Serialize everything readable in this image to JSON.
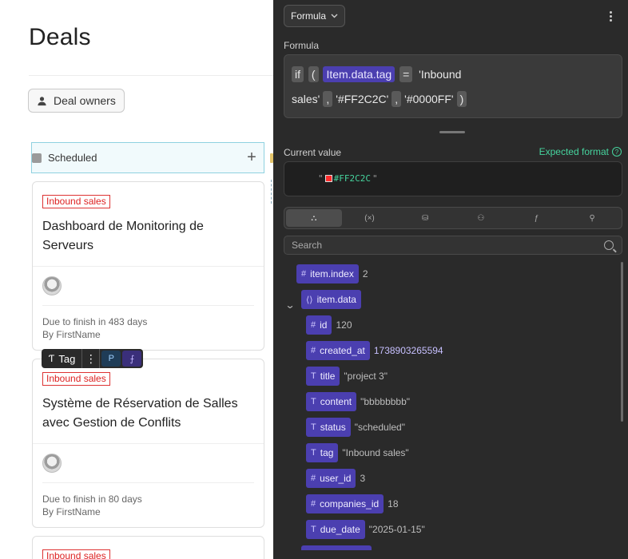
{
  "board": {
    "title": "Deals",
    "owners_button": "Deal owners",
    "column": {
      "label": "Scheduled",
      "add": "+"
    },
    "cards": [
      {
        "tag": "Inbound sales",
        "title": "Dashboard de Monitoring de Serveurs",
        "due": "Due to finish in 483 days",
        "by": "By FirstName"
      },
      {
        "tag": "Inbound sales",
        "title": "Système de Réservation de Salles avec Gestion de Conflits",
        "due": "Due to finish in 80 days",
        "by": "By FirstName"
      },
      {
        "tag": "Inbound sales"
      }
    ],
    "toolbar": {
      "tag_label": "Tag",
      "more": "⋮",
      "p": "P",
      "f": "⨍"
    }
  },
  "panel": {
    "select_label": "Formula",
    "formula_label": "Formula",
    "formula_tokens": {
      "if": "if",
      "open": "(",
      "var": "Item.data.tag",
      "eq": "=",
      "str1_a": "'Inbound",
      "str1_b": "sales'",
      "comma": ",",
      "str2": "'#FF2C2C'",
      "str3": "'#0000FF'",
      "close": ")"
    },
    "current_label": "Current value",
    "expected_label": "Expected format",
    "current_value": "#FF2C2C",
    "current_color": "#FF2C2C",
    "search_placeholder": "Search",
    "tabs": [
      "⛬",
      "(×)",
      "⛁",
      "⚇",
      "ƒ",
      "⚲"
    ],
    "tree": [
      {
        "glyph": "#",
        "key": "item.index",
        "value": "2"
      },
      {
        "glyph": "⟨⟩",
        "key": "item.data",
        "value": ""
      },
      {
        "glyph": "#",
        "key": "id",
        "value": "120"
      },
      {
        "glyph": "#",
        "key": "created_at",
        "value": "1738903265594"
      },
      {
        "glyph": "T",
        "key": "title",
        "value": "\"project 3\""
      },
      {
        "glyph": "T",
        "key": "content",
        "value": "\"bbbbbbbb\""
      },
      {
        "glyph": "T",
        "key": "status",
        "value": "\"scheduled\""
      },
      {
        "glyph": "T",
        "key": "tag",
        "value": "\"Inbound sales\""
      },
      {
        "glyph": "#",
        "key": "user_id",
        "value": "3"
      },
      {
        "glyph": "#",
        "key": "companies_id",
        "value": "18"
      },
      {
        "glyph": "T",
        "key": "due_date",
        "value": "\"2025-01-15\""
      }
    ]
  },
  "colors": {
    "panel_bg": "#2a2a2a",
    "pill": "#4b3fb0",
    "accent_green": "#46d49e",
    "tag_red": "#dd2222"
  }
}
